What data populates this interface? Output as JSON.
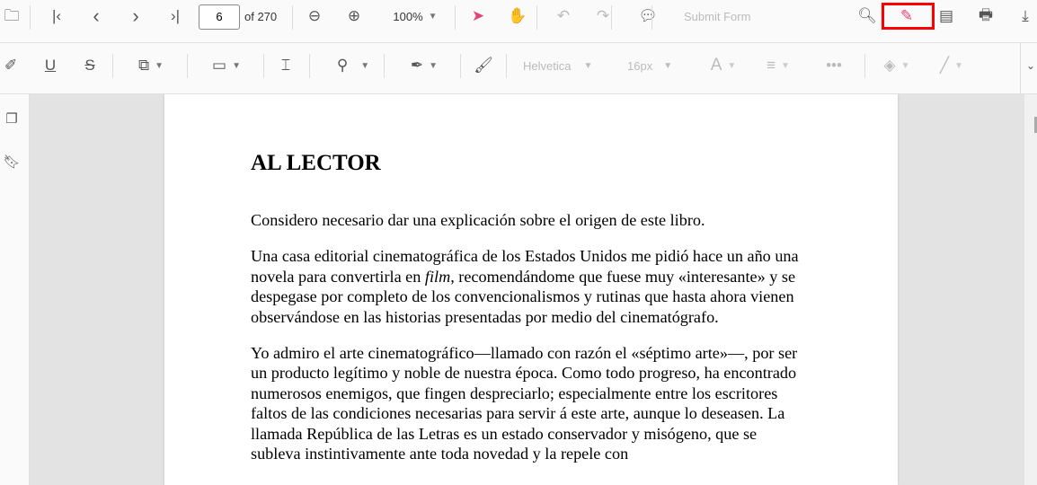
{
  "toolbar": {
    "page_number": "6",
    "page_total": "of 270",
    "zoom": "100%",
    "submit_form": "Submit Form"
  },
  "annotation_toolbar": {
    "font": "Helvetica",
    "font_size": "16px",
    "font_color_glyph": "A"
  },
  "document": {
    "heading": "AL LECTOR",
    "p1": "Considero necesario dar una explicación sobre el origen de este libro.",
    "p2a": "Una casa editorial cinematográfica de los Estados Unidos me pidió hace un año una novela para convertirla en ",
    "p2_italic": "film",
    "p2b": ", recomendándome que fuese muy «interesante» y se despegase por completo de los convencionalismos y rutinas que hasta ahora vienen observándose en las historias presentadas por medio del cinematógrafo.",
    "p3": "Yo admiro el arte cinematográfico—llamado con razón el «séptimo arte»—, por ser un producto legítimo y noble de nuestra época. Como todo progreso, ha encontrado numerosos enemigos, que fingen despreciarlo; especialmente entre los escritores faltos de las condiciones necesarias para servir á este arte, aunque lo deseasen. La llamada República de las Letras es un estado conservador y misógeno, que se subleva instintivamente ante toda novedad y la repele con"
  },
  "colors": {
    "accent": "#e8407a",
    "highlight": "#ff0000"
  }
}
